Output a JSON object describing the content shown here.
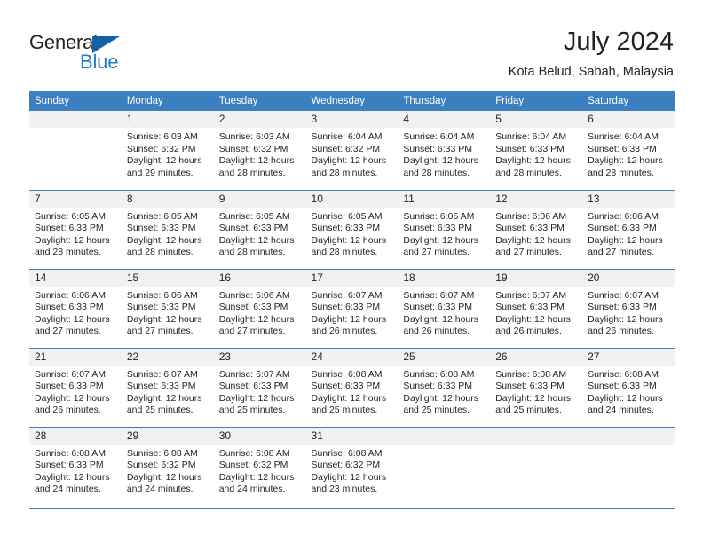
{
  "logo": {
    "word1": "General",
    "word2": "Blue",
    "triangle_icon": "triangle-right-icon",
    "color_dark": "#231f20",
    "color_blue": "#1f7ec4"
  },
  "header": {
    "title": "July 2024",
    "subtitle": "Kota Belud, Sabah, Malaysia"
  },
  "theme": {
    "header_bg": "#3c7fbf",
    "daynum_bg": "#f1f1f1",
    "grid_line": "#3c7fbf",
    "text": "#231f20"
  },
  "calendar": {
    "weekday_headers": [
      "Sunday",
      "Monday",
      "Tuesday",
      "Wednesday",
      "Thursday",
      "Friday",
      "Saturday"
    ],
    "weeks": [
      [
        {
          "day": "",
          "blank": true,
          "sunrise": "",
          "sunset": "",
          "daylight_line1": "",
          "daylight_line2": ""
        },
        {
          "day": "1",
          "sunrise": "Sunrise: 6:03 AM",
          "sunset": "Sunset: 6:32 PM",
          "daylight_line1": "Daylight: 12 hours",
          "daylight_line2": "and 29 minutes."
        },
        {
          "day": "2",
          "sunrise": "Sunrise: 6:03 AM",
          "sunset": "Sunset: 6:32 PM",
          "daylight_line1": "Daylight: 12 hours",
          "daylight_line2": "and 28 minutes."
        },
        {
          "day": "3",
          "sunrise": "Sunrise: 6:04 AM",
          "sunset": "Sunset: 6:32 PM",
          "daylight_line1": "Daylight: 12 hours",
          "daylight_line2": "and 28 minutes."
        },
        {
          "day": "4",
          "sunrise": "Sunrise: 6:04 AM",
          "sunset": "Sunset: 6:33 PM",
          "daylight_line1": "Daylight: 12 hours",
          "daylight_line2": "and 28 minutes."
        },
        {
          "day": "5",
          "sunrise": "Sunrise: 6:04 AM",
          "sunset": "Sunset: 6:33 PM",
          "daylight_line1": "Daylight: 12 hours",
          "daylight_line2": "and 28 minutes."
        },
        {
          "day": "6",
          "sunrise": "Sunrise: 6:04 AM",
          "sunset": "Sunset: 6:33 PM",
          "daylight_line1": "Daylight: 12 hours",
          "daylight_line2": "and 28 minutes."
        }
      ],
      [
        {
          "day": "7",
          "sunrise": "Sunrise: 6:05 AM",
          "sunset": "Sunset: 6:33 PM",
          "daylight_line1": "Daylight: 12 hours",
          "daylight_line2": "and 28 minutes."
        },
        {
          "day": "8",
          "sunrise": "Sunrise: 6:05 AM",
          "sunset": "Sunset: 6:33 PM",
          "daylight_line1": "Daylight: 12 hours",
          "daylight_line2": "and 28 minutes."
        },
        {
          "day": "9",
          "sunrise": "Sunrise: 6:05 AM",
          "sunset": "Sunset: 6:33 PM",
          "daylight_line1": "Daylight: 12 hours",
          "daylight_line2": "and 28 minutes."
        },
        {
          "day": "10",
          "sunrise": "Sunrise: 6:05 AM",
          "sunset": "Sunset: 6:33 PM",
          "daylight_line1": "Daylight: 12 hours",
          "daylight_line2": "and 28 minutes."
        },
        {
          "day": "11",
          "sunrise": "Sunrise: 6:05 AM",
          "sunset": "Sunset: 6:33 PM",
          "daylight_line1": "Daylight: 12 hours",
          "daylight_line2": "and 27 minutes."
        },
        {
          "day": "12",
          "sunrise": "Sunrise: 6:06 AM",
          "sunset": "Sunset: 6:33 PM",
          "daylight_line1": "Daylight: 12 hours",
          "daylight_line2": "and 27 minutes."
        },
        {
          "day": "13",
          "sunrise": "Sunrise: 6:06 AM",
          "sunset": "Sunset: 6:33 PM",
          "daylight_line1": "Daylight: 12 hours",
          "daylight_line2": "and 27 minutes."
        }
      ],
      [
        {
          "day": "14",
          "sunrise": "Sunrise: 6:06 AM",
          "sunset": "Sunset: 6:33 PM",
          "daylight_line1": "Daylight: 12 hours",
          "daylight_line2": "and 27 minutes."
        },
        {
          "day": "15",
          "sunrise": "Sunrise: 6:06 AM",
          "sunset": "Sunset: 6:33 PM",
          "daylight_line1": "Daylight: 12 hours",
          "daylight_line2": "and 27 minutes."
        },
        {
          "day": "16",
          "sunrise": "Sunrise: 6:06 AM",
          "sunset": "Sunset: 6:33 PM",
          "daylight_line1": "Daylight: 12 hours",
          "daylight_line2": "and 27 minutes."
        },
        {
          "day": "17",
          "sunrise": "Sunrise: 6:07 AM",
          "sunset": "Sunset: 6:33 PM",
          "daylight_line1": "Daylight: 12 hours",
          "daylight_line2": "and 26 minutes."
        },
        {
          "day": "18",
          "sunrise": "Sunrise: 6:07 AM",
          "sunset": "Sunset: 6:33 PM",
          "daylight_line1": "Daylight: 12 hours",
          "daylight_line2": "and 26 minutes."
        },
        {
          "day": "19",
          "sunrise": "Sunrise: 6:07 AM",
          "sunset": "Sunset: 6:33 PM",
          "daylight_line1": "Daylight: 12 hours",
          "daylight_line2": "and 26 minutes."
        },
        {
          "day": "20",
          "sunrise": "Sunrise: 6:07 AM",
          "sunset": "Sunset: 6:33 PM",
          "daylight_line1": "Daylight: 12 hours",
          "daylight_line2": "and 26 minutes."
        }
      ],
      [
        {
          "day": "21",
          "sunrise": "Sunrise: 6:07 AM",
          "sunset": "Sunset: 6:33 PM",
          "daylight_line1": "Daylight: 12 hours",
          "daylight_line2": "and 26 minutes."
        },
        {
          "day": "22",
          "sunrise": "Sunrise: 6:07 AM",
          "sunset": "Sunset: 6:33 PM",
          "daylight_line1": "Daylight: 12 hours",
          "daylight_line2": "and 25 minutes."
        },
        {
          "day": "23",
          "sunrise": "Sunrise: 6:07 AM",
          "sunset": "Sunset: 6:33 PM",
          "daylight_line1": "Daylight: 12 hours",
          "daylight_line2": "and 25 minutes."
        },
        {
          "day": "24",
          "sunrise": "Sunrise: 6:08 AM",
          "sunset": "Sunset: 6:33 PM",
          "daylight_line1": "Daylight: 12 hours",
          "daylight_line2": "and 25 minutes."
        },
        {
          "day": "25",
          "sunrise": "Sunrise: 6:08 AM",
          "sunset": "Sunset: 6:33 PM",
          "daylight_line1": "Daylight: 12 hours",
          "daylight_line2": "and 25 minutes."
        },
        {
          "day": "26",
          "sunrise": "Sunrise: 6:08 AM",
          "sunset": "Sunset: 6:33 PM",
          "daylight_line1": "Daylight: 12 hours",
          "daylight_line2": "and 25 minutes."
        },
        {
          "day": "27",
          "sunrise": "Sunrise: 6:08 AM",
          "sunset": "Sunset: 6:33 PM",
          "daylight_line1": "Daylight: 12 hours",
          "daylight_line2": "and 24 minutes."
        }
      ],
      [
        {
          "day": "28",
          "sunrise": "Sunrise: 6:08 AM",
          "sunset": "Sunset: 6:33 PM",
          "daylight_line1": "Daylight: 12 hours",
          "daylight_line2": "and 24 minutes."
        },
        {
          "day": "29",
          "sunrise": "Sunrise: 6:08 AM",
          "sunset": "Sunset: 6:32 PM",
          "daylight_line1": "Daylight: 12 hours",
          "daylight_line2": "and 24 minutes."
        },
        {
          "day": "30",
          "sunrise": "Sunrise: 6:08 AM",
          "sunset": "Sunset: 6:32 PM",
          "daylight_line1": "Daylight: 12 hours",
          "daylight_line2": "and 24 minutes."
        },
        {
          "day": "31",
          "sunrise": "Sunrise: 6:08 AM",
          "sunset": "Sunset: 6:32 PM",
          "daylight_line1": "Daylight: 12 hours",
          "daylight_line2": "and 23 minutes."
        },
        {
          "day": "",
          "blank": true,
          "sunrise": "",
          "sunset": "",
          "daylight_line1": "",
          "daylight_line2": ""
        },
        {
          "day": "",
          "blank": true,
          "sunrise": "",
          "sunset": "",
          "daylight_line1": "",
          "daylight_line2": ""
        },
        {
          "day": "",
          "blank": true,
          "sunrise": "",
          "sunset": "",
          "daylight_line1": "",
          "daylight_line2": ""
        }
      ]
    ]
  }
}
